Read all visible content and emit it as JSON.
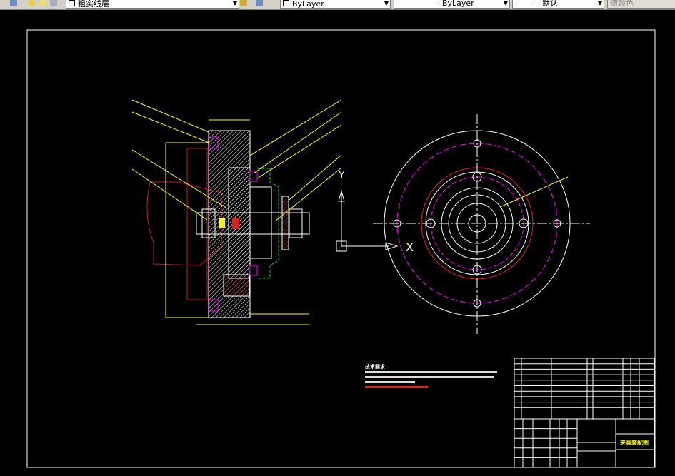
{
  "toolbar": {
    "layer": "粗实线层",
    "color": "ByLayer",
    "linetype": "ByLayer",
    "lineweight": "默认",
    "plotstyle": "随颜色"
  },
  "drawing": {
    "title": "夹具装配图",
    "tech_heading": "技术要求",
    "axis_y": "Y",
    "axis_x": "X",
    "colors": {
      "border": "#ffffff",
      "dimension": "#ffff00",
      "hidden": "#ff0000",
      "center": "#ff00ff",
      "green": "#00cc00"
    }
  }
}
